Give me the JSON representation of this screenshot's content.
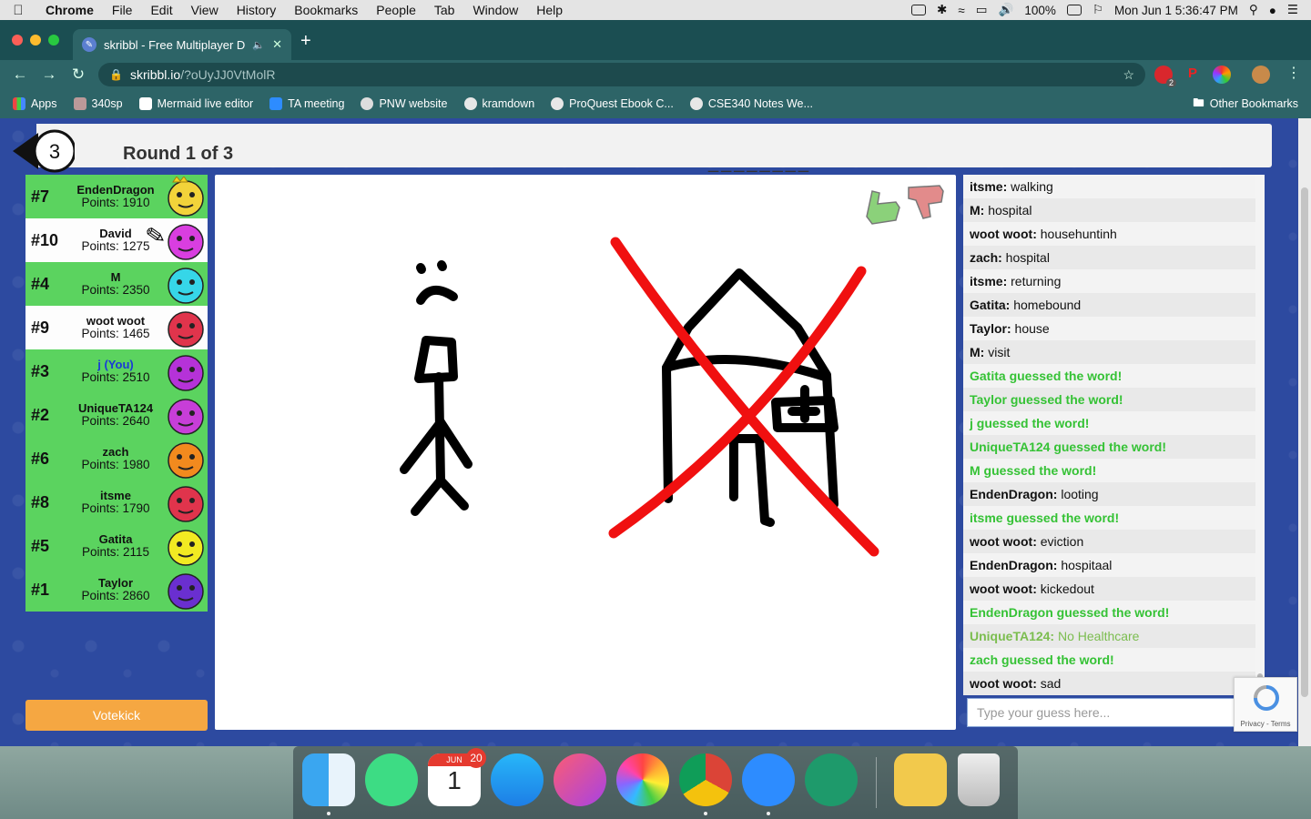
{
  "menubar": {
    "app_name": "Chrome",
    "items": [
      "File",
      "Edit",
      "View",
      "History",
      "Bookmarks",
      "People",
      "Tab",
      "Window",
      "Help"
    ],
    "battery": "100%",
    "datetime": "Mon Jun 1  5:36:47 PM"
  },
  "browser": {
    "tab_title": "skribbl - Free Multiplayer D",
    "url_host": "skribbl.io",
    "url_path": "/?oUyJJ0VtMolR",
    "extension_badge": "2"
  },
  "bookmarks": {
    "items": [
      "Apps",
      "340sp",
      "Mermaid live editor",
      "TA meeting",
      "PNW website",
      "kramdown",
      "ProQuest Ebook C...",
      "CSE340 Notes We..."
    ],
    "other": "Other Bookmarks"
  },
  "game": {
    "timer": "3",
    "round_text": "Round 1 of 3",
    "word_blanks": "________",
    "players": [
      {
        "rank": "#7",
        "name": "EndenDragon",
        "points": "Points: 1910",
        "color": "#f2d33a",
        "bg": "green",
        "crown": true
      },
      {
        "rank": "#10",
        "name": "David",
        "points": "Points: 1275",
        "color": "#d93ee0",
        "bg": "white",
        "drawing": true
      },
      {
        "rank": "#4",
        "name": "M",
        "points": "Points: 2350",
        "color": "#36d6e8",
        "bg": "green"
      },
      {
        "rank": "#9",
        "name": "woot woot",
        "points": "Points: 1465",
        "color": "#e0344c",
        "bg": "white"
      },
      {
        "rank": "#3",
        "name": "j (You)",
        "points": "Points: 2510",
        "color": "#b532d8",
        "bg": "green",
        "you": true
      },
      {
        "rank": "#2",
        "name": "UniqueTA124",
        "points": "Points: 2640",
        "color": "#c73ed8",
        "bg": "green"
      },
      {
        "rank": "#6",
        "name": "zach",
        "points": "Points: 1980",
        "color": "#f28a1e",
        "bg": "green"
      },
      {
        "rank": "#8",
        "name": "itsme",
        "points": "Points: 1790",
        "color": "#e0344c",
        "bg": "green"
      },
      {
        "rank": "#5",
        "name": "Gatita",
        "points": "Points: 2115",
        "color": "#f2ea22",
        "bg": "green"
      },
      {
        "rank": "#1",
        "name": "Taylor",
        "points": "Points: 2860",
        "color": "#6a2fd0",
        "bg": "green"
      }
    ],
    "votekick_label": "Votekick",
    "guess_placeholder": "Type your guess here...",
    "recaptcha_links": "Privacy - Terms"
  },
  "chat": [
    {
      "type": "msg",
      "who": "itsme:",
      "text": " walking"
    },
    {
      "type": "msg",
      "who": "M:",
      "text": " hospital"
    },
    {
      "type": "msg",
      "who": "woot woot:",
      "text": " househuntinh"
    },
    {
      "type": "msg",
      "who": "zach:",
      "text": " hospital"
    },
    {
      "type": "msg",
      "who": "itsme:",
      "text": " returning"
    },
    {
      "type": "msg",
      "who": "Gatita:",
      "text": " homebound"
    },
    {
      "type": "msg",
      "who": "Taylor:",
      "text": " house"
    },
    {
      "type": "msg",
      "who": "M:",
      "text": " visit"
    },
    {
      "type": "guess",
      "text": "Gatita guessed the word!"
    },
    {
      "type": "guess",
      "text": "Taylor guessed the word!"
    },
    {
      "type": "guess",
      "text": "j guessed the word!"
    },
    {
      "type": "guess",
      "text": "UniqueTA124 guessed the word!"
    },
    {
      "type": "guess",
      "text": "M guessed the word!"
    },
    {
      "type": "msg",
      "who": "EndenDragon:",
      "text": " looting"
    },
    {
      "type": "guess",
      "text": "itsme guessed the word!"
    },
    {
      "type": "msg",
      "who": "woot woot:",
      "text": " eviction"
    },
    {
      "type": "msg",
      "who": "EndenDragon:",
      "text": " hospitaal"
    },
    {
      "type": "msg",
      "who": "woot woot:",
      "text": " kickedout"
    },
    {
      "type": "guess",
      "text": "EndenDragon guessed the word!"
    },
    {
      "type": "close",
      "who": "UniqueTA124:",
      "text": " No Healthcare"
    },
    {
      "type": "guess",
      "text": "zach guessed the word!"
    },
    {
      "type": "msg",
      "who": "woot woot:",
      "text": " sad"
    }
  ],
  "dock": {
    "calendar_month": "JUN",
    "calendar_day": "1",
    "calendar_badge": "20"
  }
}
